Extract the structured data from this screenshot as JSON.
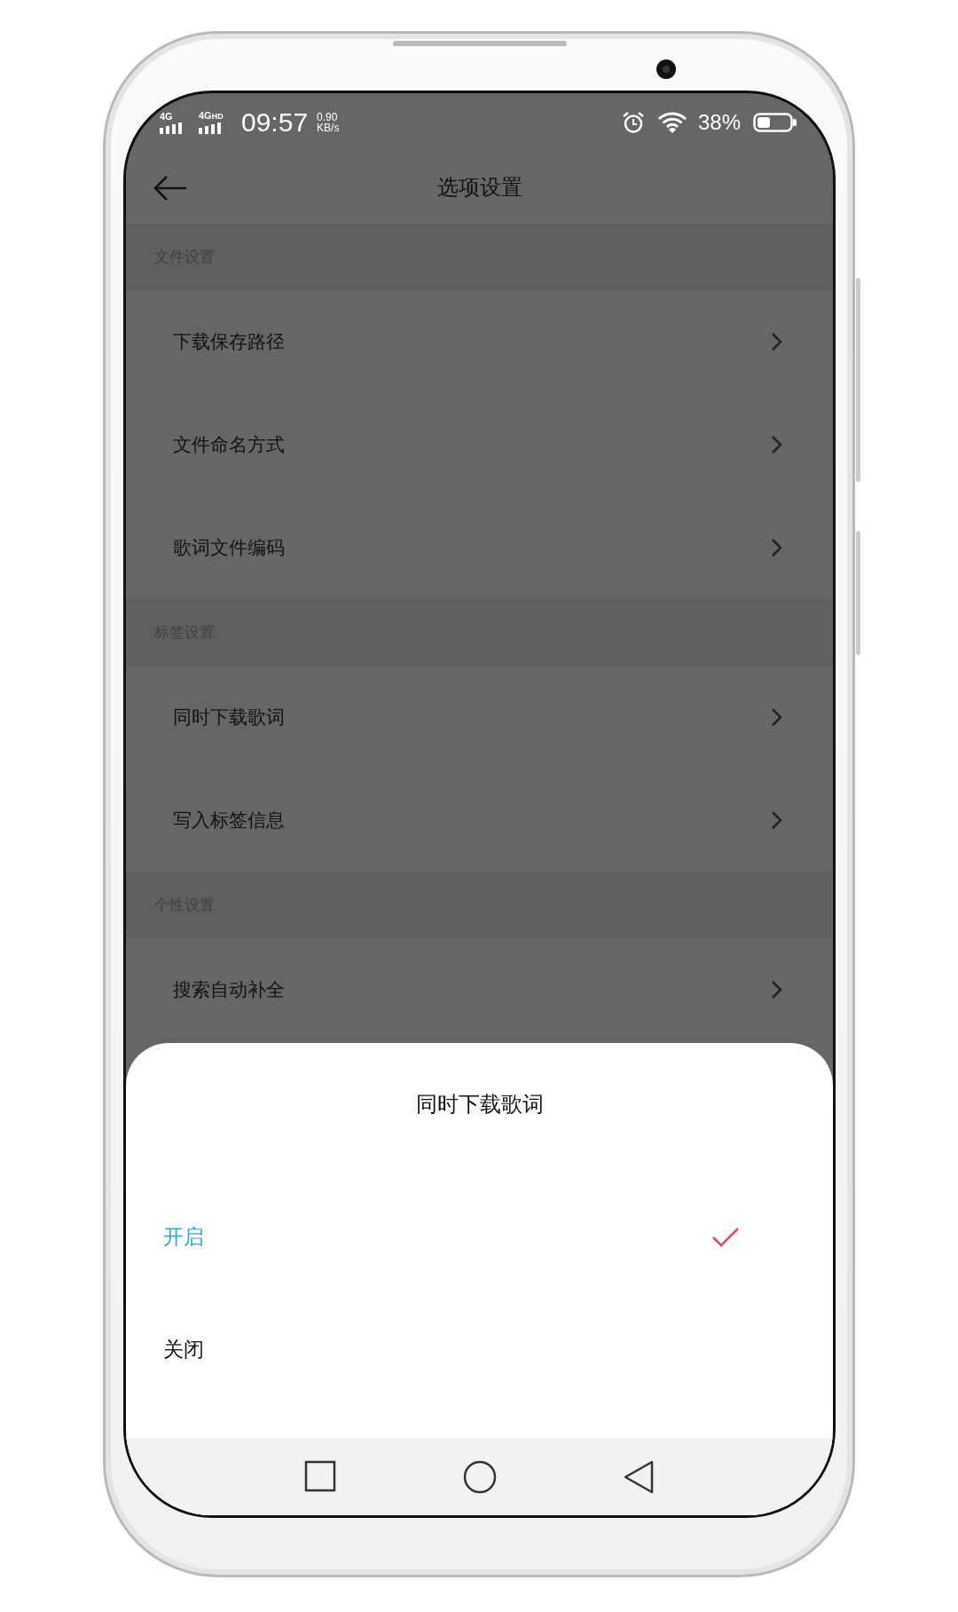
{
  "status_bar": {
    "signal_1": "4G",
    "signal_2": "4G",
    "signal_2_badge": "HD",
    "time": "09:57",
    "speed_value": "0.90",
    "speed_unit": "KB/s",
    "battery": "38%"
  },
  "header": {
    "title": "选项设置"
  },
  "sections": [
    {
      "title": "文件设置",
      "items": [
        "下载保存路径",
        "文件命名方式",
        "歌词文件编码"
      ]
    },
    {
      "title": "标签设置",
      "items": [
        "同时下载歌词",
        "写入标签信息"
      ]
    },
    {
      "title": "个性设置",
      "items": [
        "搜索自动补全"
      ]
    }
  ],
  "sheet": {
    "title": "同时下载歌词",
    "options": [
      {
        "label": "开启",
        "selected": true
      },
      {
        "label": "关闭",
        "selected": false
      }
    ]
  }
}
